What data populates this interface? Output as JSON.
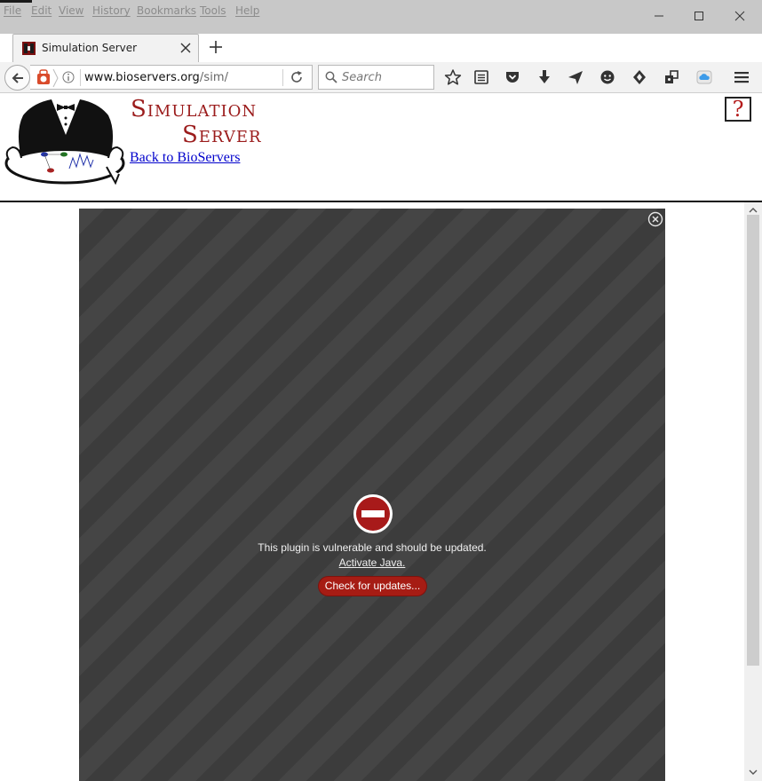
{
  "menu": {
    "items": [
      "File",
      "Edit",
      "View",
      "History",
      "Bookmarks",
      "Tools",
      "Help"
    ]
  },
  "tab": {
    "title": "Simulation Server",
    "new_tab": "+"
  },
  "nav": {
    "url_domain": "www.bioservers.org",
    "url_path": "/sim/",
    "search_placeholder": "Search"
  },
  "page": {
    "title_line1": "Simulation",
    "title_line2": "Server",
    "back_link": "Back to BioServers",
    "help": "?"
  },
  "plugin": {
    "message": "This plugin is vulnerable and should be updated.",
    "activate": "Activate Java.",
    "update_button": "Check for updates..."
  },
  "colors": {
    "title": "#9b1c1c",
    "link": "#0000cc",
    "plugin_bg": "#3c3c3c",
    "button": "#a61c14"
  }
}
